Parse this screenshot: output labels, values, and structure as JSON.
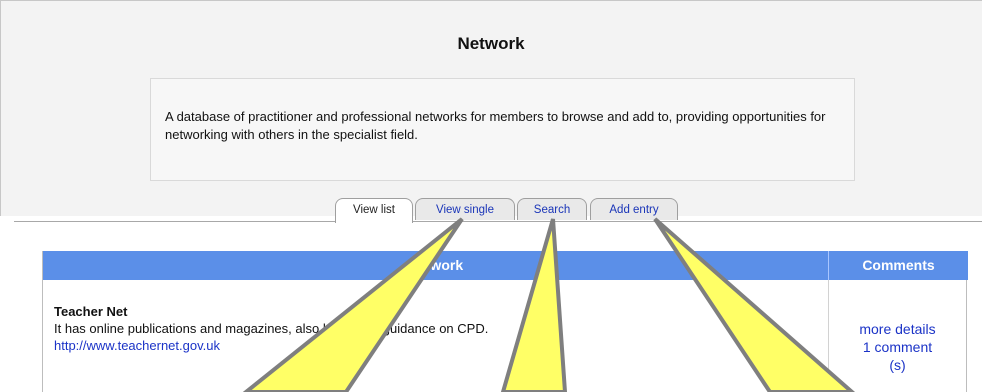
{
  "page": {
    "title": "Network",
    "description": "A database of practitioner and professional networks for members to browse and add to, providing opportunities for networking with others in the specialist field."
  },
  "tabs": [
    {
      "label": "View list",
      "state": "selected"
    },
    {
      "label": "View single"
    },
    {
      "label": "Search"
    },
    {
      "label": "Add entry"
    }
  ],
  "table": {
    "headers": [
      "Network",
      "Comments"
    ],
    "rows": [
      {
        "name": "Teacher Net",
        "description": "It has online publications and magazines, also has some guidance on CPD.",
        "url": "http://www.teachernet.gov.uk",
        "comments": [
          "more details",
          "1 comment",
          "(s)"
        ]
      }
    ]
  },
  "colors": {
    "header_blue": "#5b8fe8",
    "link_blue": "#1b33c7",
    "callout_yellow": "#ffff66"
  }
}
